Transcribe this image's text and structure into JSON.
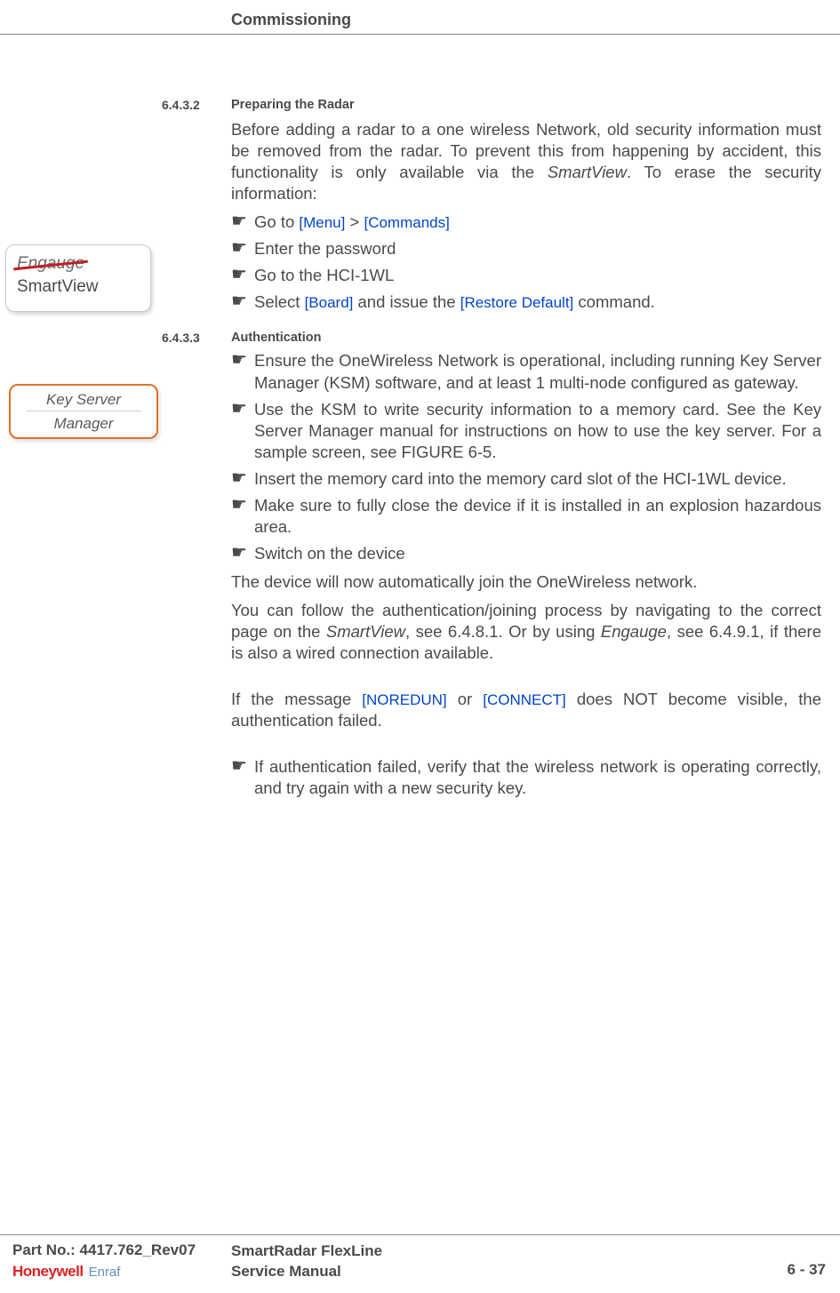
{
  "header": {
    "title": "Commissioning"
  },
  "sections": {
    "s1": {
      "num": "6.4.3.2",
      "title": "Preparing the Radar"
    },
    "s2": {
      "num": "6.4.3.3",
      "title": "Authentication"
    }
  },
  "paras": {
    "intro1a": "Before adding a  radar to a one wireless Network, old security information must be removed from the radar. To prevent this from happening by accident, this functionality is only available via the ",
    "intro1b": "SmartView",
    "intro1c": ". To erase the security information:",
    "b1a": "Go to ",
    "ref_menu": "[Menu]",
    "gt": " > ",
    "ref_commands": "[Commands]",
    "b2": "Enter the password",
    "b3": "Go to the HCI-1WL",
    "b4a": "Select ",
    "ref_board": "[Board]",
    "b4b": " and issue the ",
    "ref_restore": "[Restore Default]",
    "b4c": " command.",
    "auth_b1": "Ensure the OneWireless Network is operational, including running Key Server Manager (KSM) software, and at least 1 multi-node configured as gateway.",
    "auth_b2": "Use the KSM to write security information to a memory card. See the Key Server Manager manual for instructions on how to use the key server. For a sample screen, see FIGURE 6-5.",
    "auth_b3": "Insert the memory card into the memory card slot of the HCI-1WL device.",
    "auth_b4": "Make sure to fully close the device if it is installed in an explosion hazardous area.",
    "auth_b5": "Switch on the device",
    "auth_p1": "The device will now automatically join the OneWireless network.",
    "auth_p2a": "You can follow the authentication/joining process by navigating to the correct page on the ",
    "auth_p2b": "SmartView",
    "auth_p2c": ", see 6.4.8.1. Or by using ",
    "auth_p2d": "Engauge",
    "auth_p2e": ", see 6.4.9.1, if there is also a wired connection available.",
    "auth_p3a": "If the message ",
    "ref_noredun": "[NOREDUN]",
    "auth_p3b": " or ",
    "ref_connect": "[CONNECT]",
    "auth_p3c": " does NOT become visible, the authentication failed.",
    "auth_b6": "If authentication failed, verify that the wireless network is operating correctly, and try again with a new security key."
  },
  "illustrations": {
    "smartview": {
      "strike": "Engauge",
      "keep": "SmartView"
    },
    "keyserver": {
      "line1": "Key Server",
      "line2": "Manager"
    }
  },
  "footer": {
    "part": "Part No.: 4417.762_Rev07",
    "logo_hw": "Honeywell",
    "logo_enraf": "Enraf",
    "mid1": "SmartRadar FlexLine",
    "mid2": "Service Manual",
    "page": "6 - 37"
  }
}
